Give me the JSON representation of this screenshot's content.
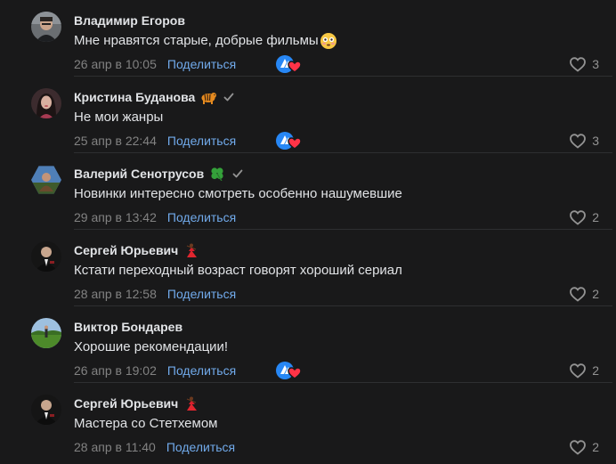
{
  "share_label": "Поделиться",
  "comments": [
    {
      "author": "Владимир Егоров",
      "text": "Мне нравятся старые, добрые фильмы",
      "text_emoji": "flushed-face",
      "date": "26 апр в 10:05",
      "likes": "3",
      "avatar": "portrait-man",
      "badge_emoji": "",
      "verified": false,
      "reaction": true
    },
    {
      "author": "Кристина Буданова",
      "text": "Не мои жанры",
      "text_emoji": "",
      "date": "25 апр в 22:44",
      "likes": "3",
      "avatar": "portrait-woman",
      "badge_emoji": "tiger",
      "verified": true,
      "reaction": true
    },
    {
      "author": "Валерий Сенотрусов",
      "text": "Новинки интересно смотреть особенно нашумевшие",
      "text_emoji": "",
      "date": "29 апр в 13:42",
      "likes": "2",
      "avatar": "portrait-outdoor",
      "badge_emoji": "four-leaf-clover",
      "verified": true,
      "reaction": false
    },
    {
      "author": "Сергей Юрьевич",
      "text": "Кстати переходный возраст говорят хороший сериал",
      "text_emoji": "",
      "date": "28 апр в 12:58",
      "likes": "2",
      "avatar": "portrait-suit",
      "badge_emoji": "dancer",
      "verified": false,
      "reaction": false
    },
    {
      "author": "Виктор Бондарев",
      "text": "Хорошие рекомендации!",
      "text_emoji": "",
      "date": "26 апр в 19:02",
      "likes": "2",
      "avatar": "portrait-landscape",
      "badge_emoji": "",
      "verified": false,
      "reaction": true
    },
    {
      "author": "Сергей Юрьевич",
      "text": "Мастера со Стетхемом",
      "text_emoji": "",
      "date": "28 апр в 11:40",
      "likes": "2",
      "avatar": "portrait-suit",
      "badge_emoji": "dancer",
      "verified": false,
      "reaction": false
    }
  ],
  "colors": {
    "background": "#19191a",
    "text": "#e1e3e6",
    "secondary": "#828282",
    "link": "#71aaeb",
    "divider": "#2e2f31",
    "reaction_blue": "#2787f5",
    "reaction_heart": "#ff3347"
  }
}
